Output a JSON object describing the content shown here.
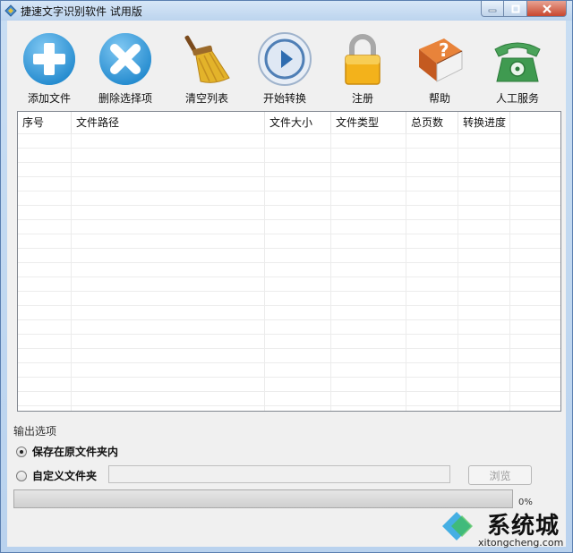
{
  "window": {
    "title": "捷速文字识别软件 试用版"
  },
  "toolbar": {
    "add_file": "添加文件",
    "delete_selected": "删除选择项",
    "clear_list": "清空列表",
    "start_convert": "开始转换",
    "register": "注册",
    "help": "帮助",
    "manual_service": "人工服务"
  },
  "table": {
    "columns": [
      "序号",
      "文件路径",
      "文件大小",
      "文件类型",
      "总页数",
      "转换进度"
    ],
    "rows": []
  },
  "output": {
    "section_title": "输出选项",
    "save_in_original": "保存在原文件夹内",
    "custom_folder": "自定义文件夹",
    "custom_path_value": "",
    "browse": "浏览",
    "selected_option": "save_in_original"
  },
  "progress": {
    "value": 0,
    "label": "0%"
  },
  "watermark": {
    "brand": "系统城",
    "url": "xitongcheng.com"
  },
  "colors": {
    "accent_blue": "#3aa6e0",
    "titlebar": "#c9def3",
    "close_red": "#c8472e"
  }
}
